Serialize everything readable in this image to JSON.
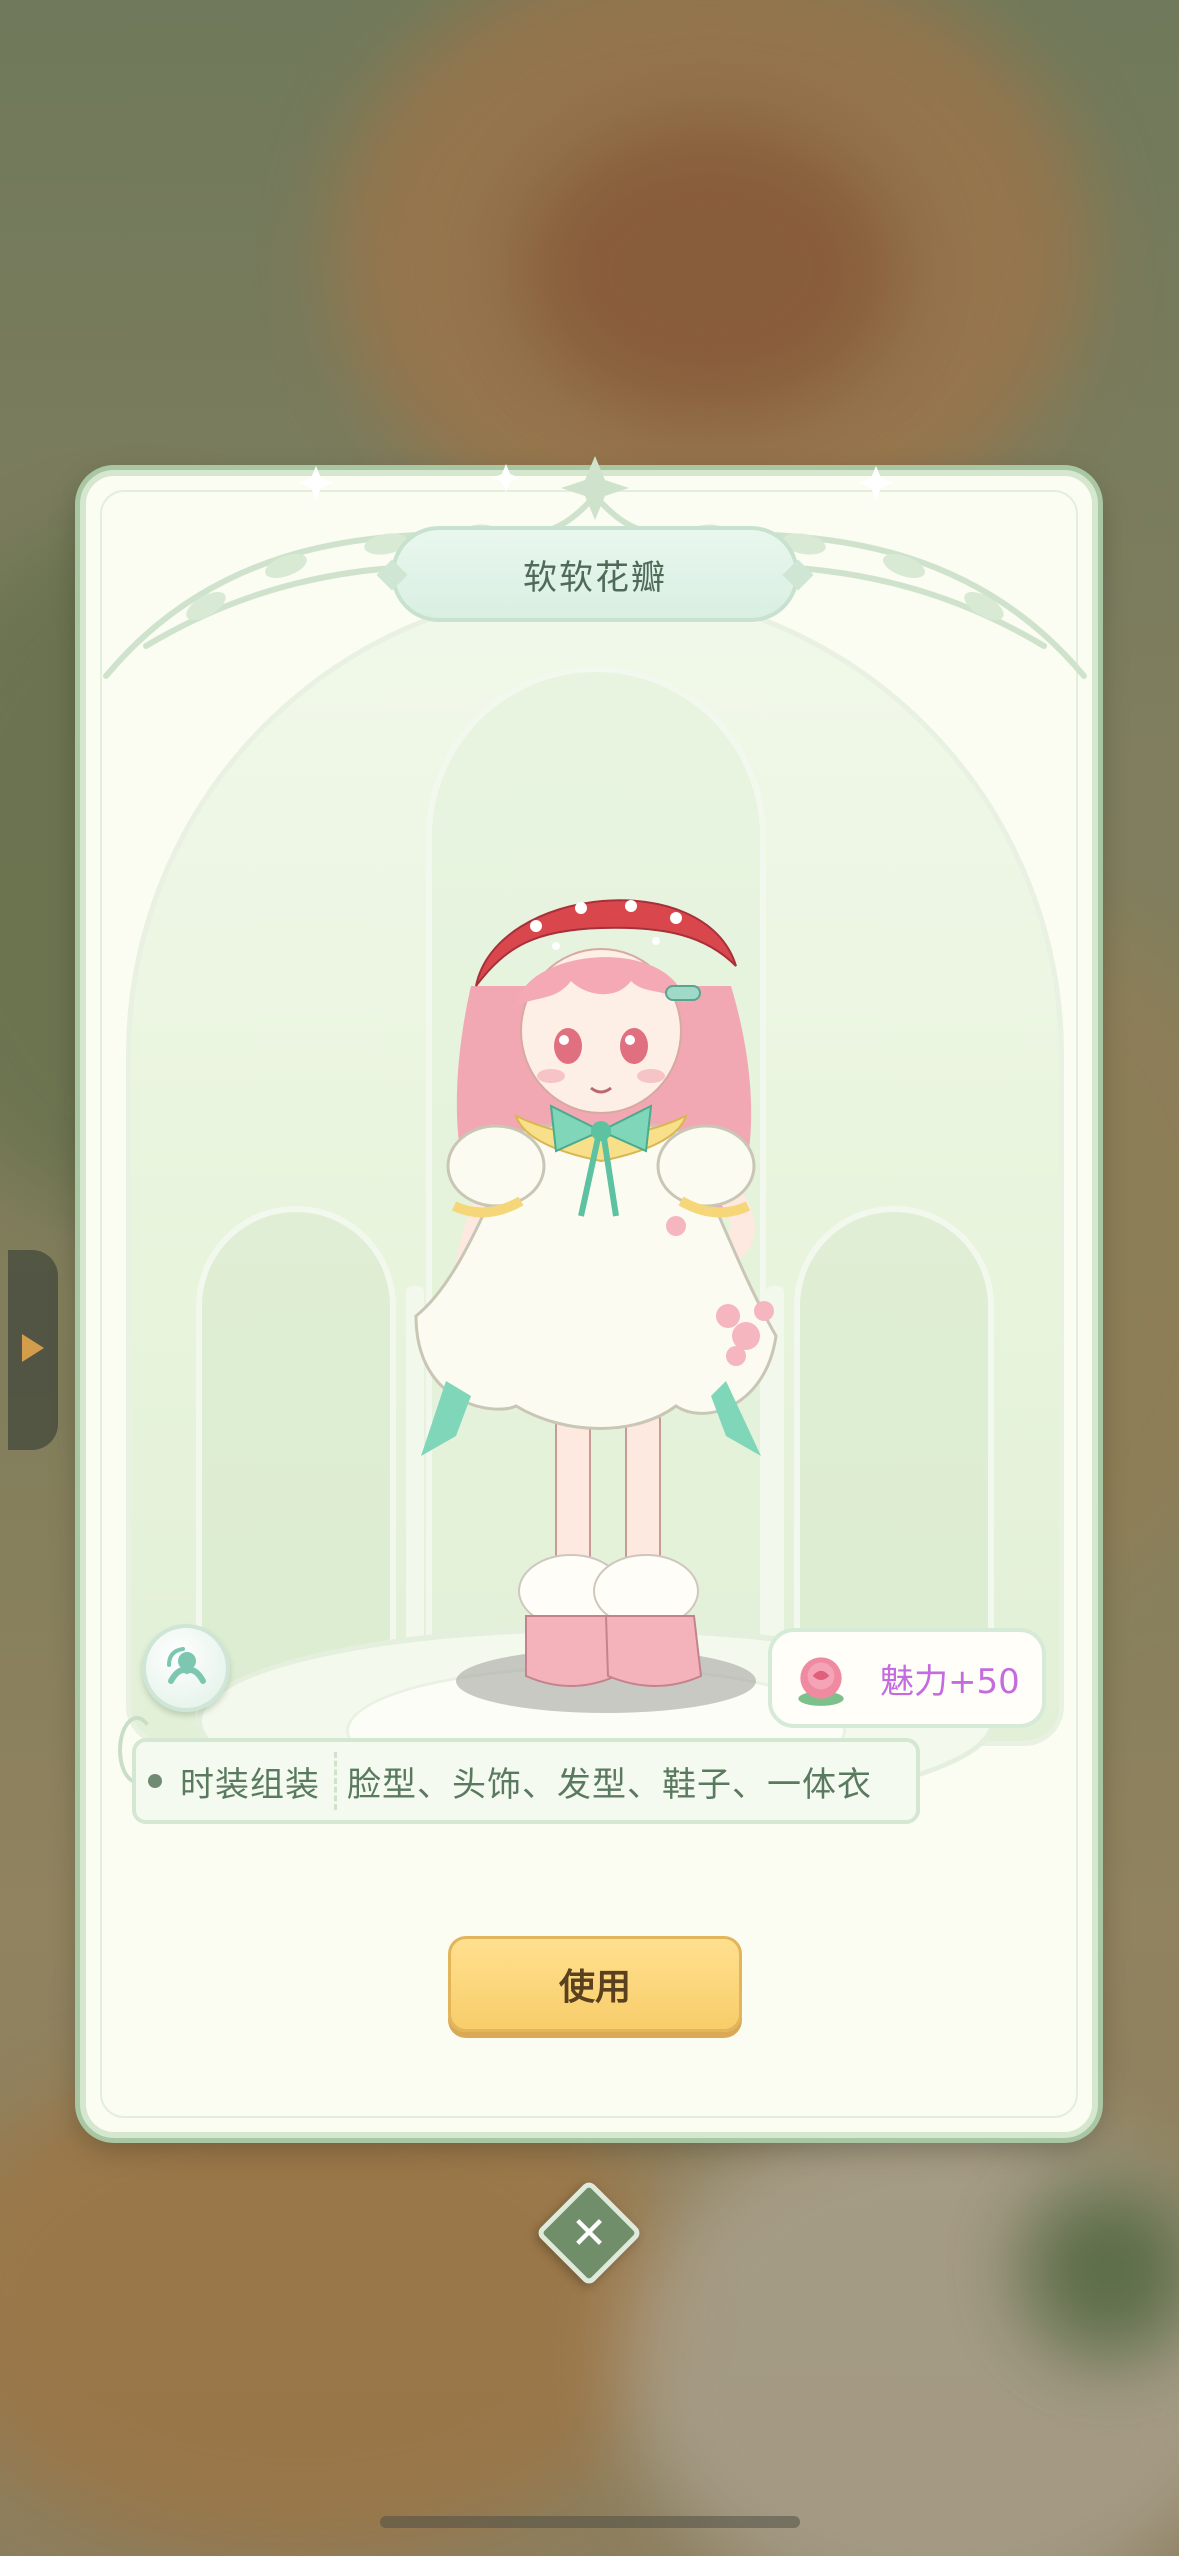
{
  "outfit": {
    "title": "软软花瓣",
    "charm_text": "魅力+50",
    "set_label": "时装组装",
    "set_items": "脸型、头饰、发型、鞋子、一体衣",
    "use_button_label": "使用"
  },
  "icons": {
    "pose": "pose-toggle-icon",
    "charm": "rose-icon",
    "close": "close-icon",
    "side": "side-arrow-icon"
  },
  "colors": {
    "card_bg": "#fbfcf2",
    "accent_green": "#6f8e69",
    "charm_purple": "#c46be0",
    "button_yellow": "#f8cd6a"
  }
}
